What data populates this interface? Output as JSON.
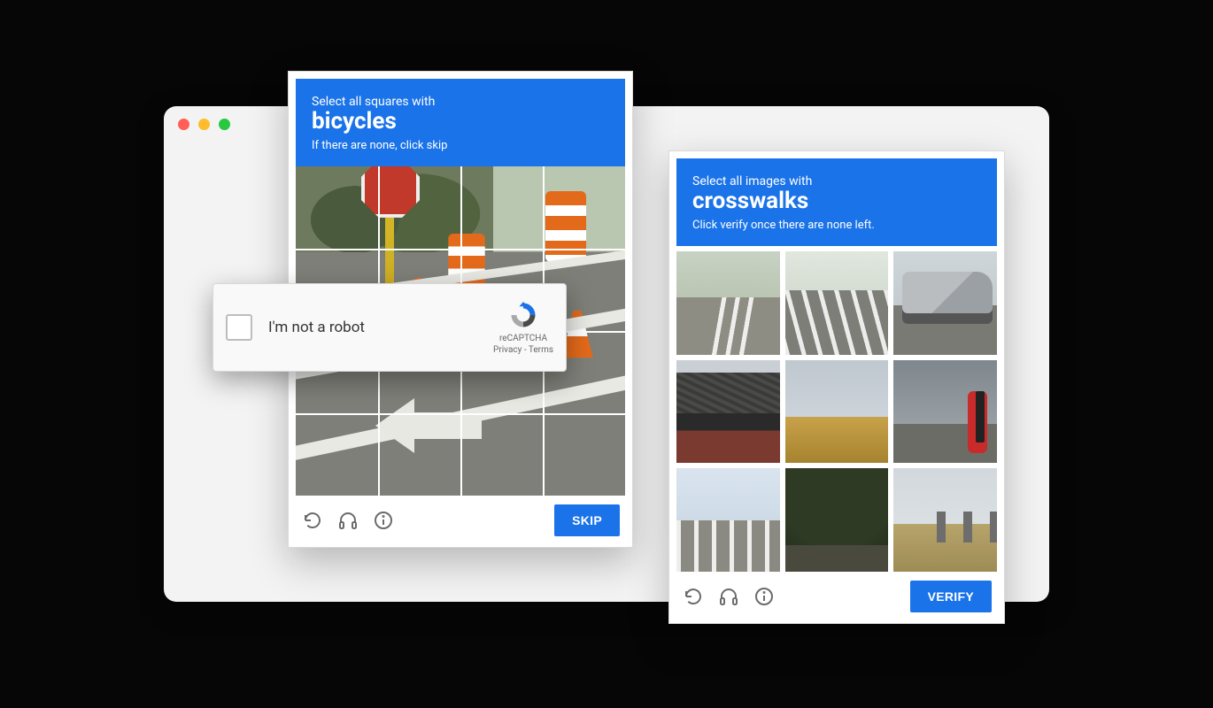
{
  "browser": {
    "traffic_lights": [
      "close",
      "minimize",
      "zoom"
    ]
  },
  "captcha_left": {
    "header_line1": "Select all squares with",
    "header_target": "bicycles",
    "header_line2": "If there are none, click skip",
    "grid_rows": 4,
    "grid_cols": 4,
    "action_label": "SKIP",
    "footer_icons": [
      "reload-icon",
      "headphones-icon",
      "info-icon"
    ]
  },
  "captcha_right": {
    "header_line1": "Select all images with",
    "header_target": "crosswalks",
    "header_line2": "Click verify once there are none left.",
    "grid_rows": 3,
    "grid_cols": 3,
    "action_label": "VERIFY",
    "footer_icons": [
      "reload-icon",
      "headphones-icon",
      "info-icon"
    ]
  },
  "recaptcha_widget": {
    "label": "I'm not a robot",
    "brand": "reCAPTCHA",
    "privacy_label": "Privacy",
    "separator": " - ",
    "terms_label": "Terms"
  }
}
